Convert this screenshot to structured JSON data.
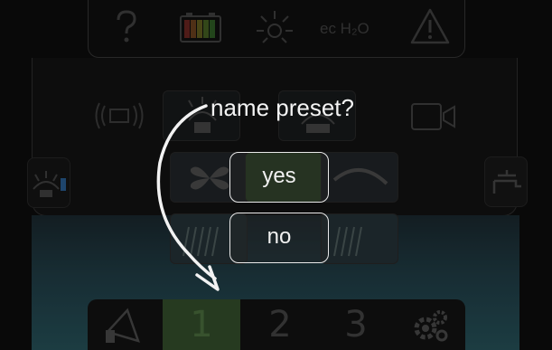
{
  "status_bar": {
    "help_icon": "question-mark",
    "battery_icon": "battery-level",
    "light_icon": "brightness-sun",
    "ec_label": "ec H₂O",
    "warning_icon": "warning-triangle"
  },
  "controls": {
    "left_side_icon": "spray-wash",
    "right_side_icon": "water-tap",
    "camera_icon": "camera",
    "vibrate_icon": "vibration"
  },
  "bottom_bar": {
    "mode_icon": "spray-nozzle",
    "presets": [
      "1",
      "2",
      "3"
    ],
    "active_preset": "1",
    "settings_icon": "gears"
  },
  "dialog": {
    "title": "name preset?",
    "yes_label": "yes",
    "no_label": "no"
  },
  "colors": {
    "active_preset": "#3b5a32",
    "dialog_text": "#f4f4f4",
    "teal_gradient": "#2b5d66"
  }
}
